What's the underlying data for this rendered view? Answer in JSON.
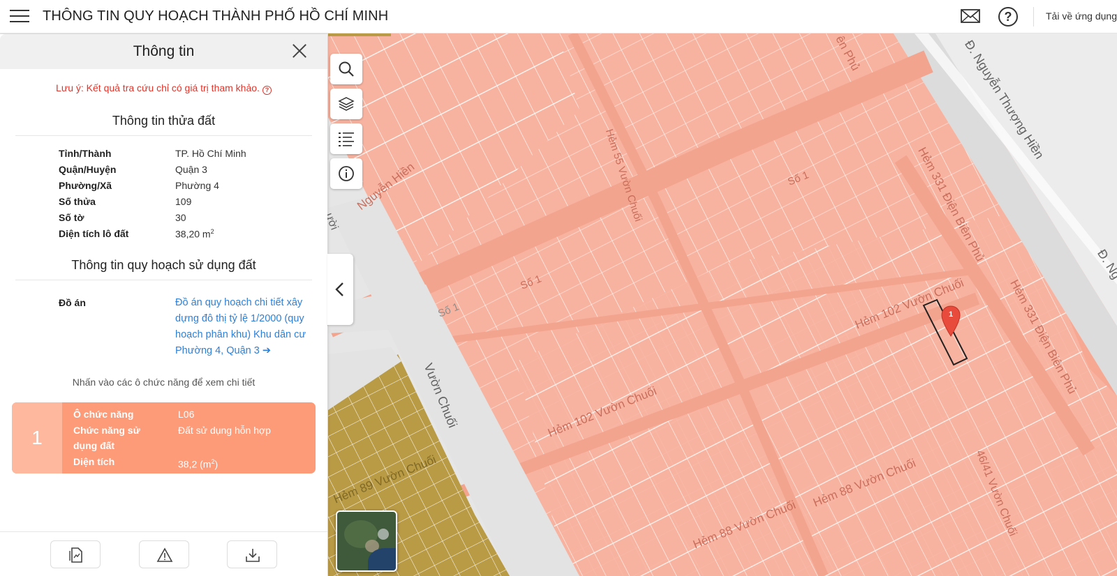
{
  "header": {
    "title": "THÔNG TIN QUY HOẠCH THÀNH PHỐ HỒ CHÍ MINH",
    "download_app": "Tải về ứng dụng",
    "icons": [
      "menu-icon",
      "mail-icon",
      "help-icon"
    ]
  },
  "panel": {
    "title": "Thông tin",
    "note": "Lưu ý: Kết quả tra cứu chỉ có giá trị tham khảo.",
    "parcel_section_title": "Thông tin thửa đất",
    "parcel": [
      {
        "label": "Tỉnh/Thành",
        "value": "TP. Hồ Chí Minh"
      },
      {
        "label": "Quận/Huyện",
        "value": "Quận 3"
      },
      {
        "label": "Phường/Xã",
        "value": "Phường 4"
      },
      {
        "label": "Số thửa",
        "value": "109"
      },
      {
        "label": "Số tờ",
        "value": "30"
      },
      {
        "label": "Diện tích lô đất",
        "value": "38,20 m",
        "unit_sup": "2"
      }
    ],
    "landuse_section_title": "Thông tin quy hoạch sử dụng đất",
    "doan_label": "Đồ án",
    "doan_link": "Đồ án quy hoạch chi tiết xây dựng đô thị tỷ lệ 1/2000 (quy hoạch phân khu) Khu dân cư Phường 4, Quận 3",
    "hint": "Nhấn vào các ô chức năng để xem chi tiết",
    "function_card": {
      "number": "1",
      "rows": [
        {
          "label": "Ô chức năng",
          "value": "L06"
        },
        {
          "label": "Chức năng sử dụng đất",
          "value": "Đất sử dụng hỗn hợp"
        },
        {
          "label": "Diện tích",
          "value": "38,2 (m",
          "sup": "2",
          "suffix": ")"
        }
      ],
      "color": "#fd9a78",
      "number_bg": "#fdb89e"
    },
    "footer_buttons": [
      "document-icon",
      "warning-icon",
      "download-icon"
    ]
  },
  "map": {
    "controls": [
      "search-icon",
      "layers-icon",
      "legend-list-icon",
      "info-icon"
    ],
    "marker_label": "1",
    "streets": [
      {
        "text": "Nguyễn Hiền"
      },
      {
        "text": "Số 1"
      },
      {
        "text": "Số 1"
      },
      {
        "text": "Số 1"
      },
      {
        "text": "Hẻm 102 Vườn Chuối"
      },
      {
        "text": "Hẻm 102 Vườn Chuối"
      },
      {
        "text": "Vườn Chuối"
      },
      {
        "text": "Hẻm 89 Vườn Chuối"
      },
      {
        "text": "Hẻm 88 Vườn Chuối"
      },
      {
        "text": "Hẻm 88 Vườn Chuối"
      },
      {
        "text": "Hẻm 331 Điện Biên Phủ"
      },
      {
        "text": "Hẻm 331 Điện Biên Phủ"
      },
      {
        "text": "Đ. Nguyễn Thượng Hiền"
      },
      {
        "text": "46/41 Vườn Chuối"
      },
      {
        "text": "Hẻm 55 Vườn Chuối"
      },
      {
        "text": "Đ. Ng"
      },
      {
        "text": "ên Phủ"
      },
      {
        "text": "ười"
      }
    ],
    "colors": {
      "residential": "#f8b5a0",
      "mixed": "#fcae97",
      "green": "#b99a45",
      "road": "#e3e3e3"
    }
  }
}
